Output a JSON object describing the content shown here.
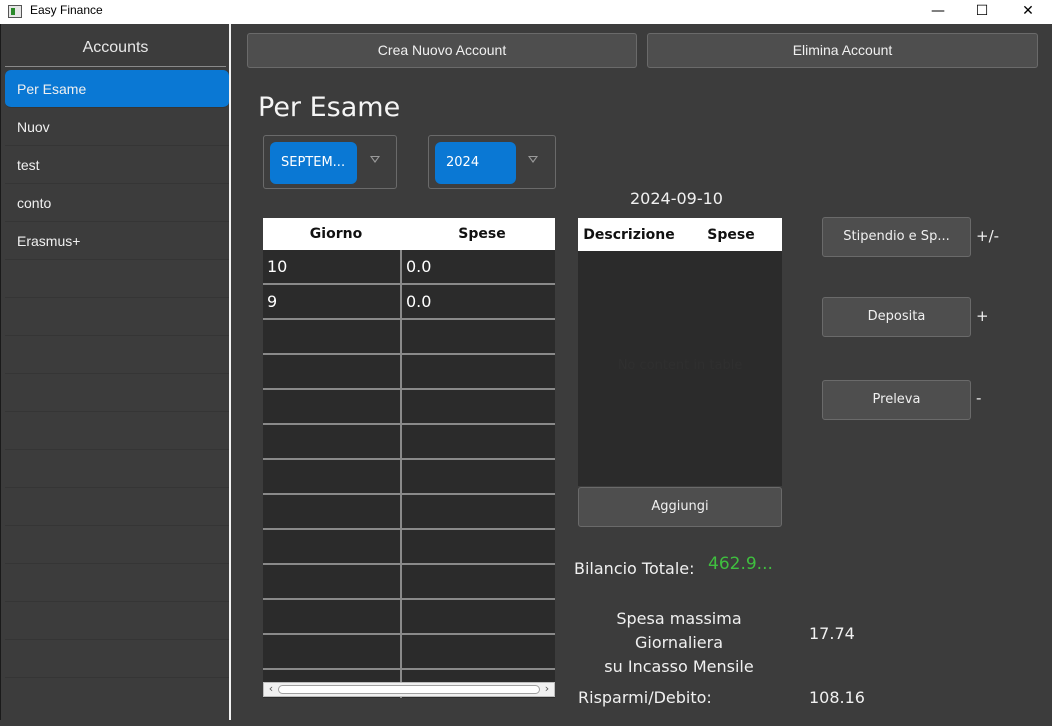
{
  "window": {
    "title": "Easy Finance",
    "minimize_glyph": "—",
    "maximize_glyph": "☐",
    "close_glyph": "✕"
  },
  "sidebar": {
    "header": "Accounts",
    "accounts": [
      "Per Esame",
      "Nuov",
      "test",
      "conto",
      "Erasmus+"
    ],
    "selected": "Per Esame"
  },
  "toolbar": {
    "create_label": "Crea Nuovo Account",
    "delete_label": "Elimina Account"
  },
  "main": {
    "account_title": "Per Esame",
    "month_selected": "SEPTEM...",
    "year_selected": "2024",
    "selected_date": "2024-09-10"
  },
  "day_table": {
    "columns": [
      "Giorno",
      "Spese"
    ],
    "rows": [
      [
        "10",
        "0.0"
      ],
      [
        "9",
        "0.0"
      ]
    ],
    "empty_rows": 11
  },
  "desc_table": {
    "columns": [
      "Descrizione",
      "Spese"
    ],
    "placeholder": "No content in table"
  },
  "actions": {
    "add_label": "Aggiungi",
    "salary_label": "Stipendio e Sp...",
    "salary_mark": "+/-",
    "deposit_label": "Deposita",
    "deposit_mark": "+",
    "withdraw_label": "Preleva",
    "withdraw_mark": "-"
  },
  "summary": {
    "balance_label": "Bilancio Totale:",
    "balance_value": "462.9...",
    "daily_max_label_line1": "Spesa massima Giornaliera",
    "daily_max_label_line2": "su Incasso Mensile",
    "daily_max_value": "17.74",
    "savings_label": "Risparmi/Debito:",
    "savings_value": "108.16"
  },
  "colors": {
    "accent": "#0a78d4",
    "background": "#3c3c3c",
    "positive": "#3fbf3f"
  }
}
